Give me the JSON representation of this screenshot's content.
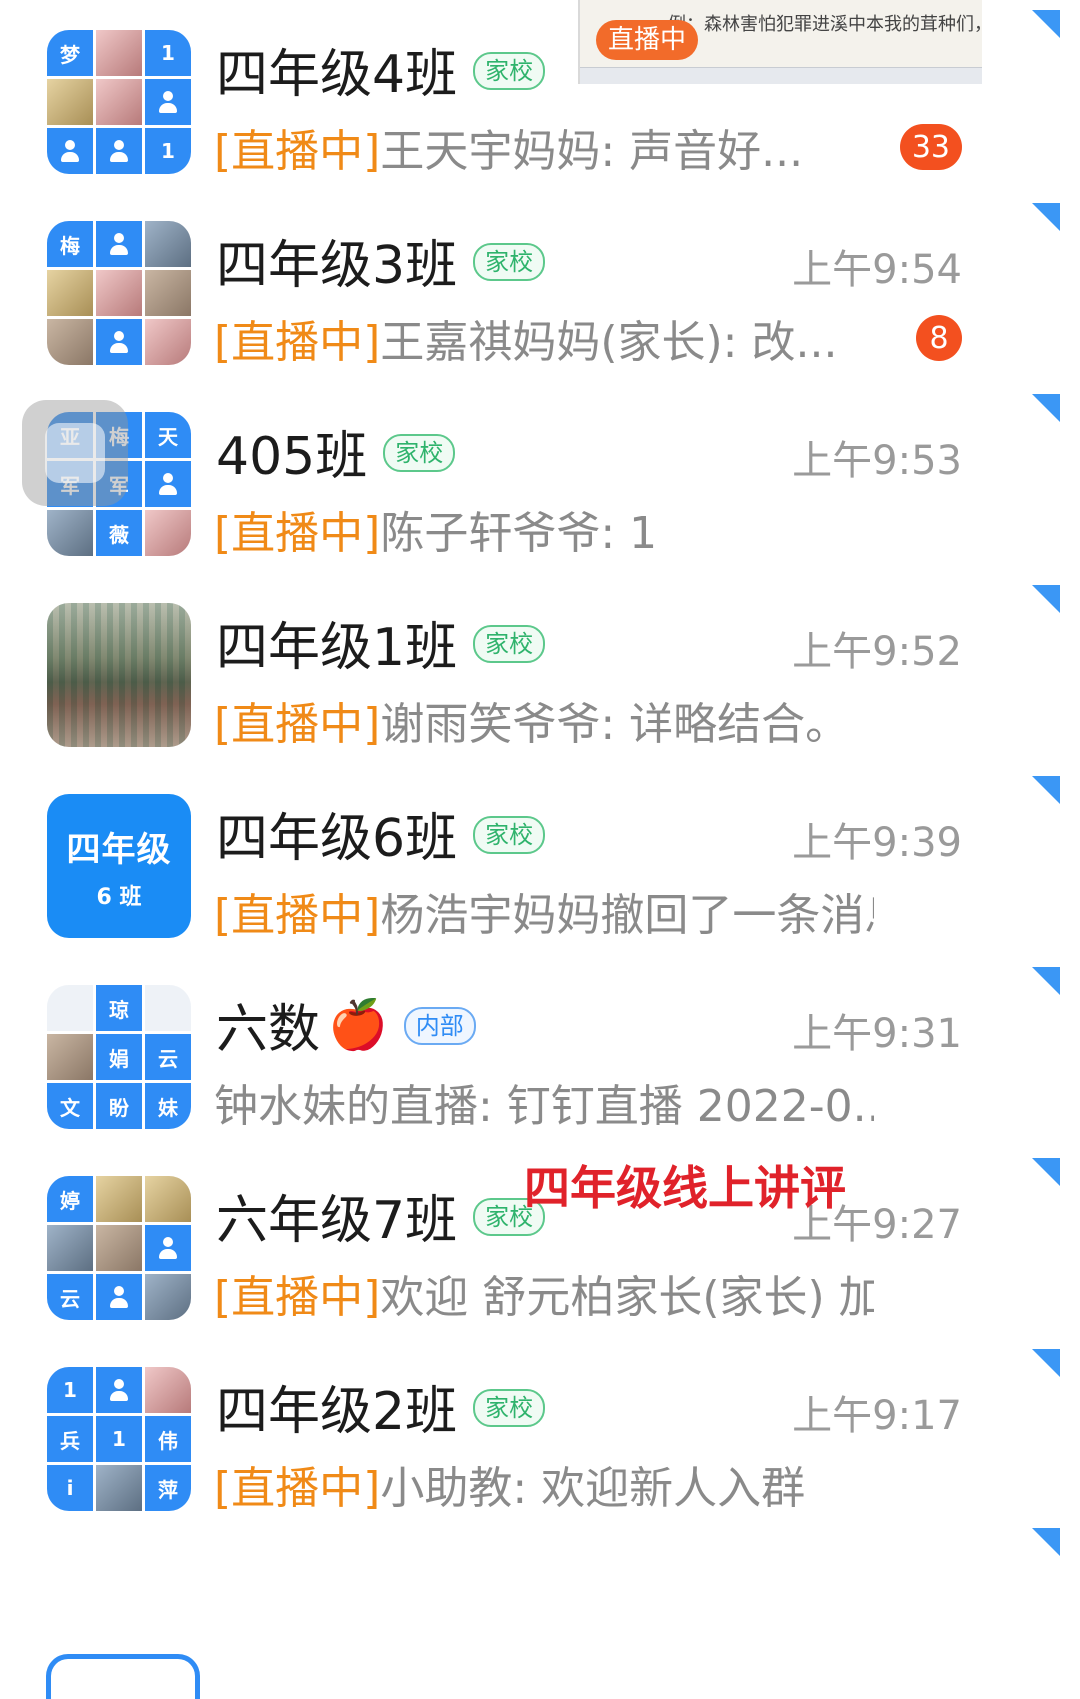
{
  "live_preview": {
    "badge": "直播中",
    "handwriting": "例：森林害怕犯罪进溪中本我的茸种们，我们不能忘记吗？"
  },
  "overlay_caption": "四年级线上讲评",
  "colors": {
    "live_prefix": "#f08a17",
    "badge_red": "#f3501f",
    "tag_green": "#2fb36c",
    "tag_blue": "#2f8cf5",
    "pin_blue": "#3b97f5"
  },
  "chats": [
    {
      "name": "四年级4班",
      "tag": "家校",
      "time": "",
      "live": "[直播中]",
      "message": "王天宇妈妈: 声音好...",
      "unread": "33",
      "avatar_labels": [
        "梦",
        "1",
        "1"
      ]
    },
    {
      "name": "四年级3班",
      "tag": "家校",
      "time": "上午9:54",
      "live": "[直播中]",
      "message": "王嘉祺妈妈(家长): 改...",
      "unread": "8",
      "avatar_labels": [
        "梅"
      ]
    },
    {
      "name": "405班",
      "tag": "家校",
      "time": "上午9:53",
      "live": "[直播中]",
      "message": "陈子轩爷爷: 1",
      "unread": "",
      "avatar_labels": [
        "亚",
        "梅",
        "天",
        "军",
        "军",
        "薇"
      ]
    },
    {
      "name": "四年级1班",
      "tag": "家校",
      "time": "上午9:52",
      "live": "[直播中]",
      "message": "谢雨笑爷爷: 详略结合。",
      "unread": "",
      "avatar_labels": []
    },
    {
      "name": "四年级6班",
      "tag": "家校",
      "time": "上午9:39",
      "live": "[直播中]",
      "message": "杨浩宇妈妈撤回了一条消息",
      "unread": "",
      "avatar_labels": [
        "四年级",
        "6 班"
      ]
    },
    {
      "name": "六数",
      "tag": "内部",
      "time": "上午9:31",
      "live": "",
      "message": "钟水妹的直播: 钉钉直播 2022-0...",
      "unread": "",
      "avatar_labels": [
        "琼",
        "娟",
        "云",
        "文",
        "盼",
        "妹"
      ]
    },
    {
      "name": "六年级7班",
      "tag": "家校",
      "time": "上午9:27",
      "live": "[直播中]",
      "message": "欢迎 舒元柏家长(家长) 加...",
      "unread": "",
      "avatar_labels": [
        "婷",
        "云"
      ]
    },
    {
      "name": "四年级2班",
      "tag": "家校",
      "time": "上午9:17",
      "live": "[直播中]",
      "message": "小助教: 欢迎新人入群",
      "unread": "",
      "avatar_labels": [
        "1",
        "兵",
        "1",
        "伟",
        "i",
        "萍"
      ]
    }
  ]
}
